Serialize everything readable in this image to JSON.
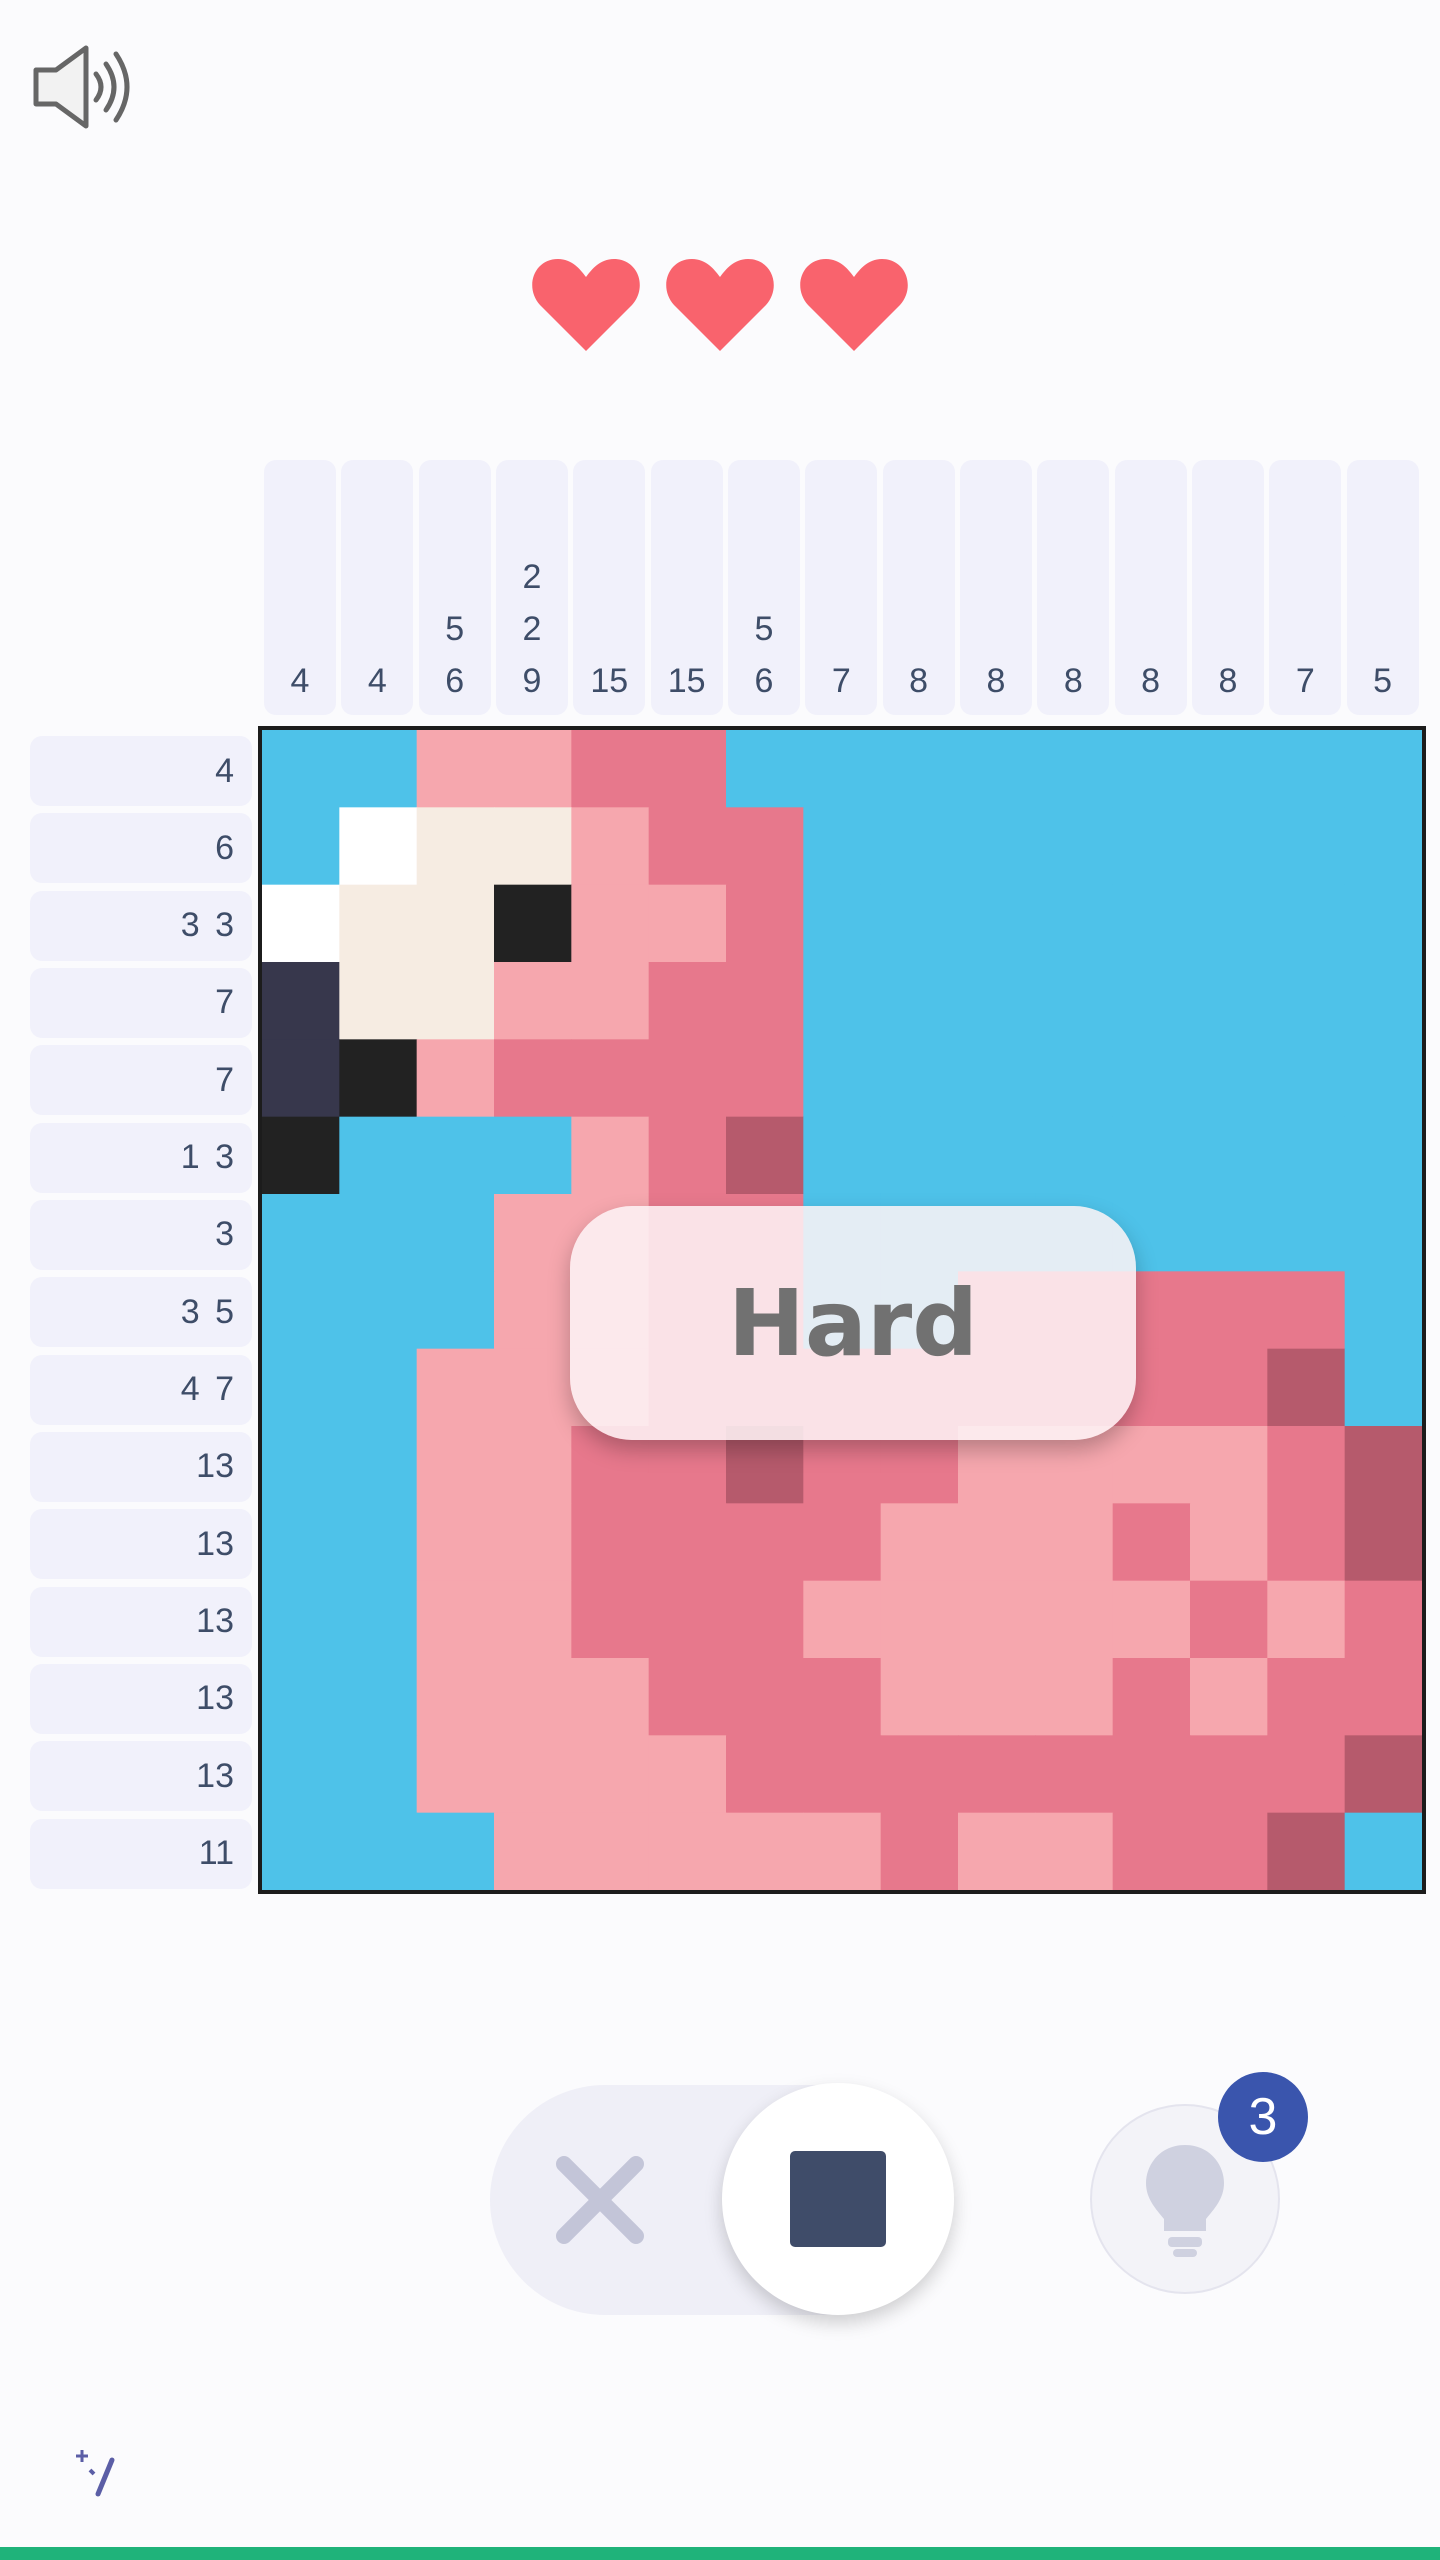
{
  "colors": {
    "sky": "#4ec2e9",
    "light_pink": "#f6a7ae",
    "pink": "#e7788c",
    "dark_pink": "#b65a6c",
    "cream": "#f6ece2",
    "white": "#ffffff",
    "black": "#222222",
    "charcoal": "#37374c",
    "heart": "#f9636d",
    "clue_text": "#3e4d68",
    "accent_dark": "#3f4c69",
    "badge": "#3a55ad"
  },
  "icons": {
    "sound": "speaker-volume-icon",
    "heart": "heart-icon",
    "cross": "cross-mark-icon",
    "fill": "filled-square-icon",
    "hint": "lightbulb-icon",
    "watermark": "sparkle-slash-icon"
  },
  "lives": {
    "remaining": 3,
    "total": 3
  },
  "column_clues": [
    [
      "4"
    ],
    [
      "4"
    ],
    [
      "5",
      "6"
    ],
    [
      "2",
      "2",
      "9"
    ],
    [
      "15"
    ],
    [
      "15"
    ],
    [
      "5",
      "6"
    ],
    [
      "7"
    ],
    [
      "8"
    ],
    [
      "8"
    ],
    [
      "8"
    ],
    [
      "8"
    ],
    [
      "8"
    ],
    [
      "7"
    ],
    [
      "5"
    ]
  ],
  "row_clues": [
    "4",
    "6",
    "3 3",
    "7",
    "7",
    "1 3",
    "3",
    "3 5",
    "4 7",
    "13",
    "13",
    "13",
    "13",
    "13",
    "11"
  ],
  "board": {
    "size": 15,
    "legend": {
      "S": "sky",
      "L": "light_pink",
      "P": "pink",
      "D": "dark_pink",
      "C": "cream",
      "W": "white",
      "K": "black",
      "G": "charcoal"
    },
    "rows": [
      "SSLLPPSSSSSSSSS",
      "SWCCLPPSSSSSSSS",
      "WCCKLLPSSSSSSSS",
      "GCCLLPPSSSSSSSS",
      "GKLPPPPSSSSSSSS",
      "KSSSLPDSSSSSSSS",
      "SSSLLPPSSSSSSSS",
      "SSSLLPPSSPPPPPS",
      "SSLLLPPPPPPPPDS",
      "SSLLPPDPPLLLLPD",
      "SSLLPPPPLLLPLPD",
      "SSLLPPPLLLLLPLP",
      "SSLLLPPPLLLPLPP",
      "SSLLLLPPPPPPPPD",
      "SSSLLLLLPLLPPDS"
    ]
  },
  "difficulty_label": "Hard",
  "hint": {
    "count": "3"
  },
  "input_mode": {
    "selected": "fill"
  }
}
